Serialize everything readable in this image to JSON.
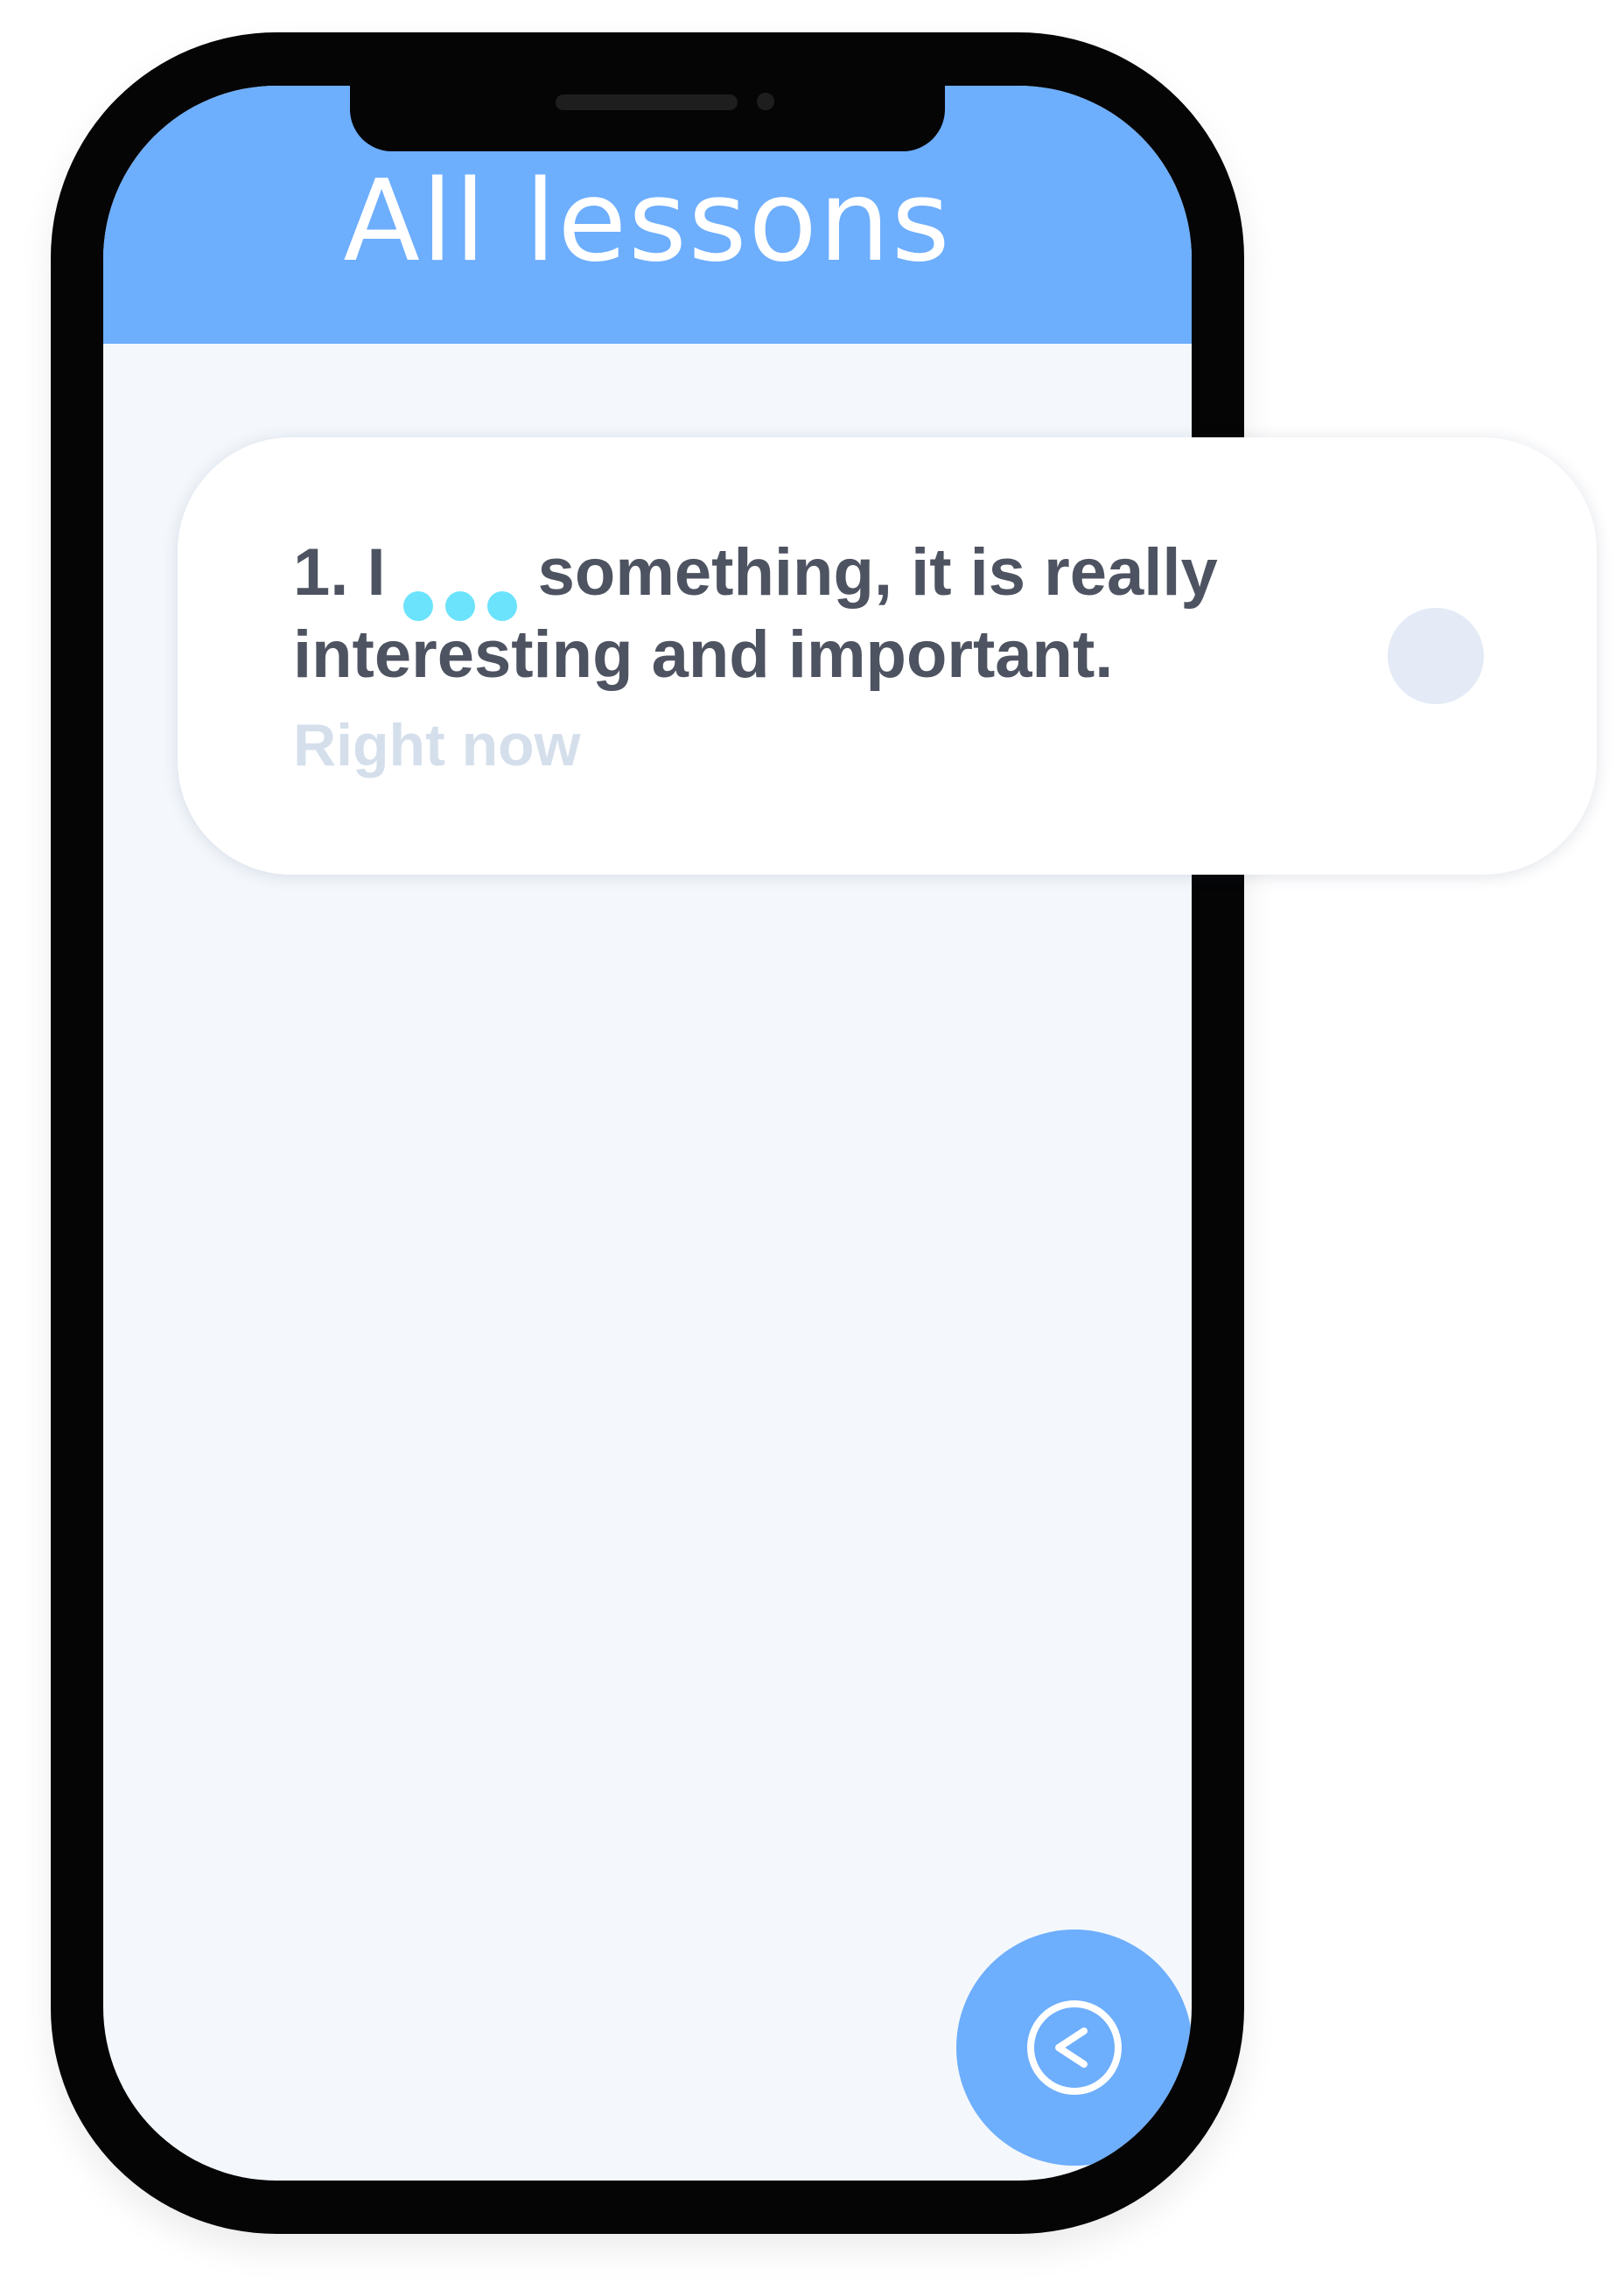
{
  "app": {
    "title": "All lessons"
  },
  "notification": {
    "number": "1.",
    "prefix": "I",
    "blank_icon": "three-dots-blank",
    "text_line1": "something, it is really",
    "text_line2": "interesting and important.",
    "time": "Right now"
  },
  "fab": {
    "icon": "back-arrow-circle-icon"
  },
  "colors": {
    "accent": "#6daefd",
    "blank_dots": "#6be3fc",
    "text": "#4e5361",
    "muted": "#d5dfec",
    "screen_bg": "#f4f8fc",
    "frame": "#050505"
  }
}
